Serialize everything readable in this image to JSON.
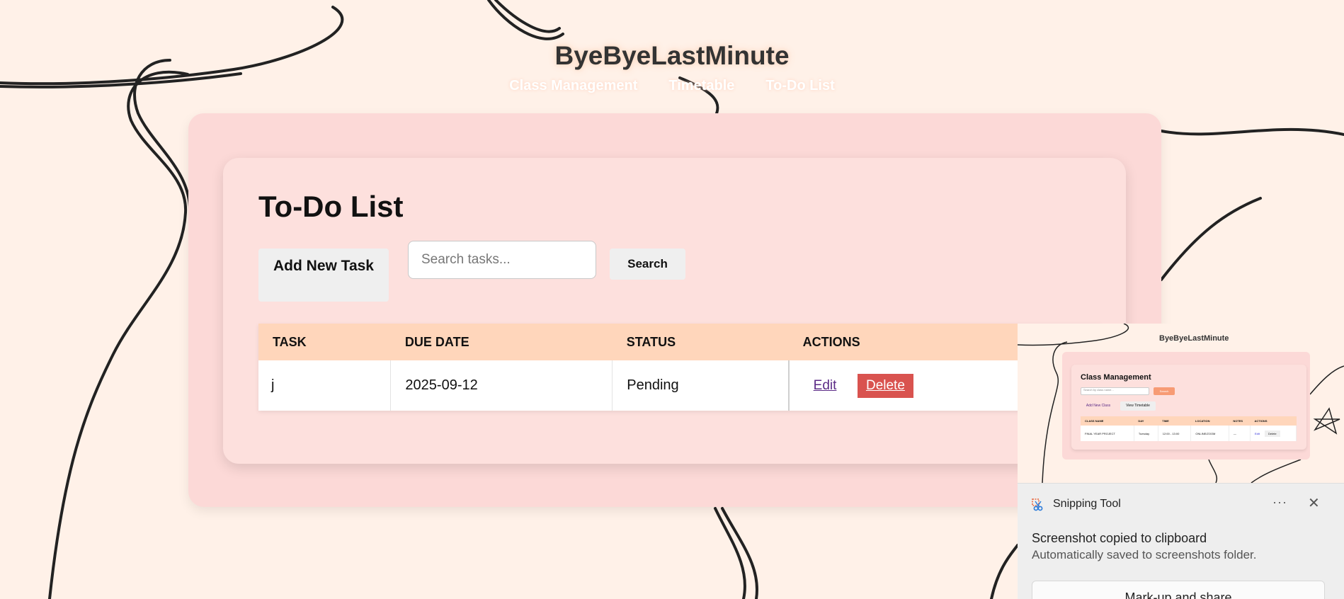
{
  "site": {
    "title": "ByeByeLastMinute",
    "nav": [
      "Class Management",
      "Timetable",
      "To-Do List"
    ]
  },
  "todo": {
    "heading": "To-Do List",
    "add_label": "Add New Task",
    "search_placeholder": "Search tasks...",
    "search_label": "Search",
    "columns": [
      "TASK",
      "DUE DATE",
      "STATUS",
      "ACTIONS"
    ],
    "rows": [
      {
        "task": "j",
        "due_date": "2025-09-12",
        "status": "Pending",
        "edit_label": "Edit",
        "delete_label": "Delete"
      }
    ]
  },
  "snipping_tool": {
    "app_name": "Snipping Tool",
    "more_icon": "ellipsis-icon",
    "close_icon": "close-icon",
    "message": "Screenshot copied to clipboard",
    "sub_message": "Automatically saved to screenshots folder.",
    "action_label": "Mark-up and share",
    "preview": {
      "title": "ByeByeLastMinute",
      "heading": "Class Management",
      "search_placeholder": "Search by class name...",
      "search_label": "Search",
      "add_label": "Add New Class",
      "view_label": "View Timetable",
      "columns": [
        "CLASS NAME",
        "DAY",
        "TIME",
        "LOCATION",
        "NOTES",
        "ACTIONS"
      ],
      "row": [
        "FINAL YEAR PROJECT",
        "Tuesday",
        "12:00 - 13:00",
        "ONLINE/ZOOM",
        "—",
        "Edit",
        "Delete"
      ]
    }
  },
  "colors": {
    "background": "#fff1e8",
    "card": "#fcd9d7",
    "table_header": "#ffd6bb",
    "delete": "#d9534f"
  }
}
